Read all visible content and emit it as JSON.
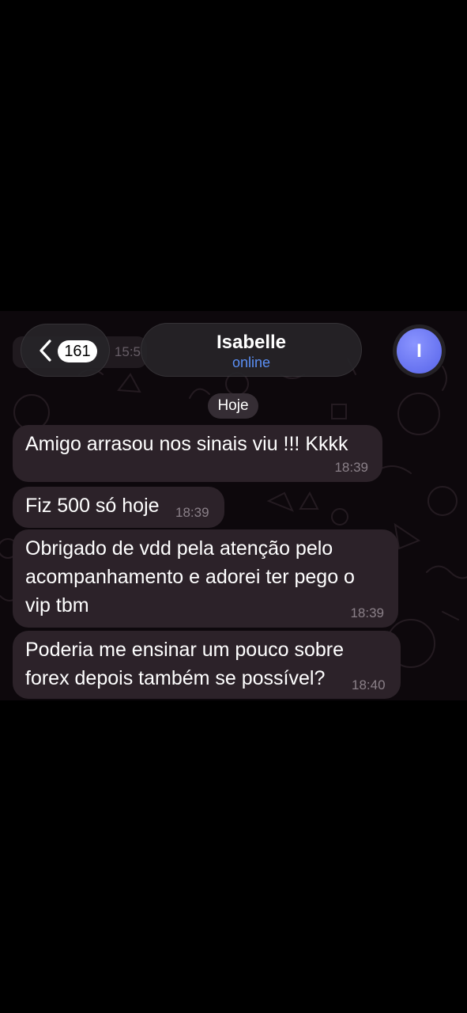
{
  "header": {
    "unread_count": "161",
    "contact_name": "Isabelle",
    "contact_status": "online",
    "avatar_initial": "I",
    "back_icon": "chevron-left-icon",
    "ghost_time": "15:5"
  },
  "chat": {
    "date_label": "Hoje",
    "messages": [
      {
        "text": "Amigo arrasou nos sinais viu !!! Kkkk",
        "time": "18:39"
      },
      {
        "text": "Fiz 500 só hoje",
        "time": "18:39"
      },
      {
        "text": "Obrigado de vdd pela atenção pelo\nacompanhamento e adorei ter pego o\nvip tbm",
        "time": "18:39"
      },
      {
        "text": "Poderia me ensinar um pouco sobre\nforex depois também se possível?",
        "time": "18:40"
      }
    ]
  },
  "colors": {
    "background": "#000000",
    "chat_wallpaper": "#0d080c",
    "bubble": "#2c2229",
    "status_blue": "#5a8ff5",
    "avatar": "#6672f0"
  }
}
